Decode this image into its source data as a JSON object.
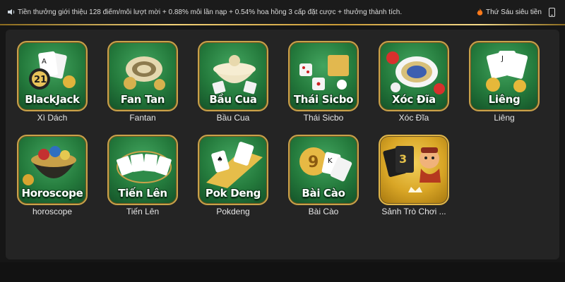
{
  "topbar": {
    "marquee_text": "Tiền thưởng giới thiệu 128 điểm/mỗi lượt mời + 0.88% mỗi lần nạp + 0.54% hoa hồng 3 cấp đặt cược + thưởng thành tích.",
    "right_text": "Thứ Sáu siêu tiền"
  },
  "colors": {
    "accent_gold": "#d4ad4f",
    "tile_green": "#247a3c",
    "background": "#161616",
    "panel": "#242424"
  },
  "games": [
    {
      "title": "BlackJack",
      "label": "Xì Dách",
      "icon": "blackjack-cards-icon"
    },
    {
      "title": "Fan Tan",
      "label": "Fantan",
      "icon": "fantan-coins-icon"
    },
    {
      "title": "Bầu Cua",
      "label": "Bầu Cua",
      "icon": "bau-cua-bowl-icon"
    },
    {
      "title": "Thái Sicbo",
      "label": "Thái Sicbo",
      "icon": "sicbo-dice-icon"
    },
    {
      "title": "Xóc Đĩa",
      "label": "Xóc Đĩa",
      "icon": "xoc-dia-plate-icon"
    },
    {
      "title": "Liêng",
      "label": "Liêng",
      "icon": "lieng-cards-icon"
    },
    {
      "title": "Horoscope",
      "label": "horoscope",
      "icon": "horoscope-pot-icon"
    },
    {
      "title": "Tiến Lên",
      "label": "Tiến Lên",
      "icon": "tien-len-table-icon"
    },
    {
      "title": "Pok Deng",
      "label": "Pokdeng",
      "icon": "pok-deng-cards-icon"
    },
    {
      "title": "Bài Cào",
      "label": "Bài Cào",
      "icon": "bai-cao-cards-icon"
    },
    {
      "title": "",
      "label": "Sảnh Trò Chơi ...",
      "icon": "game-lobby-character-icon"
    }
  ]
}
